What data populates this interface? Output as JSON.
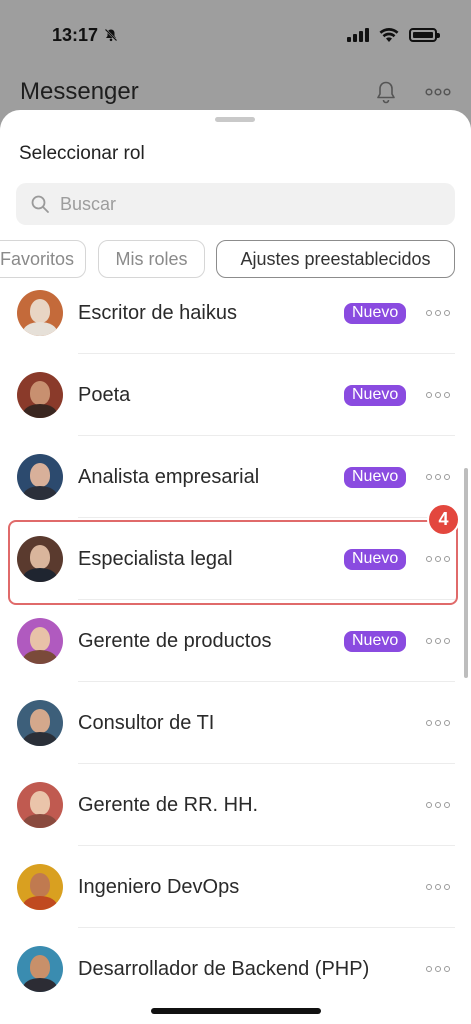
{
  "status_bar": {
    "time": "13:17"
  },
  "app": {
    "title": "Messenger"
  },
  "sheet": {
    "title": "Seleccionar rol",
    "search": {
      "placeholder": "Buscar",
      "value": ""
    },
    "chips": [
      {
        "label": "Favoritos",
        "active": false
      },
      {
        "label": "Mis roles",
        "active": false
      },
      {
        "label": "Ajustes preestablecidos",
        "active": true
      }
    ],
    "roles": [
      {
        "name": "Escritor de haikus",
        "badge": "Nuevo"
      },
      {
        "name": "Poeta",
        "badge": "Nuevo"
      },
      {
        "name": "Analista empresarial",
        "badge": "Nuevo"
      },
      {
        "name": "Especialista legal",
        "badge": "Nuevo"
      },
      {
        "name": "Gerente de productos",
        "badge": "Nuevo"
      },
      {
        "name": "Consultor de TI",
        "badge": ""
      },
      {
        "name": "Gerente de RR. HH.",
        "badge": ""
      },
      {
        "name": "Ingeniero DevOps",
        "badge": ""
      },
      {
        "name": "Desarrollador de Backend (PHP)",
        "badge": ""
      }
    ],
    "step_marker": "4"
  },
  "colors": {
    "badge": "#8a4be0",
    "highlight": "#e06a6a",
    "step_marker": "#e3473e"
  }
}
